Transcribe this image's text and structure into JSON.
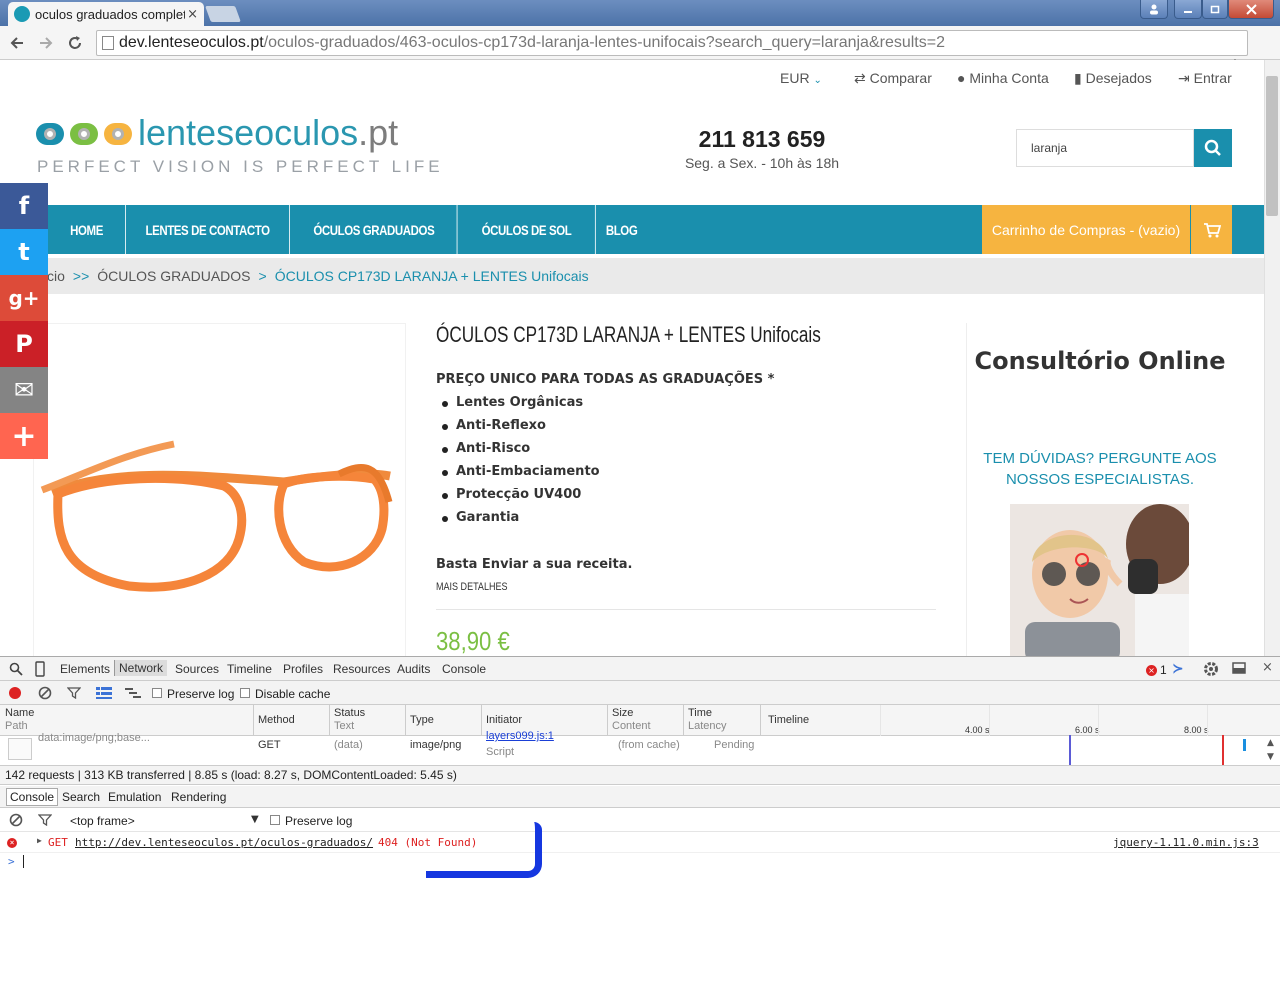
{
  "browser": {
    "tab_title": "oculos graduados completo",
    "tab_close": "×",
    "url_host": "dev.lenteseoculos.pt",
    "url_path": "/oculos-graduados/463-oculos-cp173d-laranja-lentes-unifocais?search_query=laranja&results=2",
    "icons": [
      "back-icon",
      "forward-icon",
      "reload-icon",
      "page-icon",
      "no-tracking-icon",
      "translate-icon",
      "star-icon",
      "menu-icon"
    ]
  },
  "site": {
    "currency": "EUR",
    "top_links": [
      "Comparar",
      "Minha Conta",
      "Desejados",
      "Entrar"
    ],
    "logo_main": "lenteseoculos",
    "logo_tld": ".pt",
    "logo_tagline": "PERFECT VISION IS PERFECT LIFE",
    "phone": "211 813 659",
    "hours": "Seg. a Sex. - 10h às 18h",
    "search_value": "laranja",
    "nav": [
      "HOME",
      "LENTES DE CONTACTO",
      "ÓCULOS GRADUADOS",
      "ÓCULOS DE SOL",
      "BLOG"
    ],
    "cart": "Carrinho de Compras - (vazio)",
    "breadcrumb": {
      "home": "cio",
      "sep1": ">>",
      "category": "ÓCULOS GRADUADOS",
      "sep2": ">",
      "current": "ÓCULOS CP173D LARANJA + LENTES Unifocais"
    },
    "product": {
      "title": "ÓCULOS CP173D LARANJA + LENTES Unifocais",
      "price_heading": "PREÇO UNICO PARA TODAS AS GRADUAÇÕES *",
      "features": [
        "Lentes Orgânicas",
        "Anti-Reflexo",
        "Anti-Risco",
        "Anti-Embaciamento",
        "Protecção UV400",
        "Garantia"
      ],
      "send_prescription": "Basta Enviar a sua receita.",
      "more_details": "MAIS DETALHES",
      "price": "38,90 €"
    },
    "consult": {
      "title": "Consultório Online",
      "subtitle": "TEM DÚVIDAS? PERGUNTE AOS NOSSOS ESPECIALISTAS."
    },
    "social": [
      {
        "glyph": "f",
        "color": "#3b5998",
        "name": "facebook"
      },
      {
        "glyph": "t",
        "color": "#1da1f2",
        "name": "twitter"
      },
      {
        "glyph": "g+",
        "color": "#dd4b39",
        "name": "google-plus"
      },
      {
        "glyph": "P",
        "color": "#cb2027",
        "name": "pinterest"
      },
      {
        "glyph": "✉",
        "color": "#848484",
        "name": "email"
      },
      {
        "glyph": "+",
        "color": "#ff6550",
        "name": "more"
      }
    ],
    "colors": {
      "brand": "#1a8fad",
      "cart": "#f6b440",
      "price": "#7bbf43"
    }
  },
  "devtools": {
    "tabs": [
      "Elements",
      "Network",
      "Sources",
      "Timeline",
      "Profiles",
      "Resources",
      "Audits",
      "Console"
    ],
    "error_count": "1",
    "net_toolbar": {
      "preserve_log": "Preserve log",
      "disable_cache": "Disable cache"
    },
    "columns": {
      "name": "Name",
      "name_sub": "Path",
      "method": "Method",
      "status": "Status",
      "status_sub": "Text",
      "type": "Type",
      "initiator": "Initiator",
      "size": "Size",
      "size_sub": "Content",
      "time": "Time",
      "time_sub": "Latency",
      "timeline": "Timeline",
      "ticks": [
        "4.00 s",
        "6.00 s",
        "8.00 s"
      ]
    },
    "row": {
      "name": "data:image/png;base...",
      "method": "GET",
      "status": "(data)",
      "type": "image/png",
      "initiator": "layers099.js:1",
      "initiator_sub": "Script",
      "size": "(from cache)",
      "time": "Pending"
    },
    "summary": "142 requests | 313 KB transferred | 8.85 s (load: 8.27 s, DOMContentLoaded: 5.45 s)",
    "drawer_tabs": [
      "Console",
      "Search",
      "Emulation",
      "Rendering"
    ],
    "frame": "<top frame>",
    "preserve_log": "Preserve log",
    "console": {
      "method": "GET",
      "url": "http://dev.lenteseoculos.pt/oculos-graduados/",
      "status": "404 (Not Found)",
      "source": "jquery-1.11.0.min.js:3",
      "prompt": ">"
    }
  }
}
